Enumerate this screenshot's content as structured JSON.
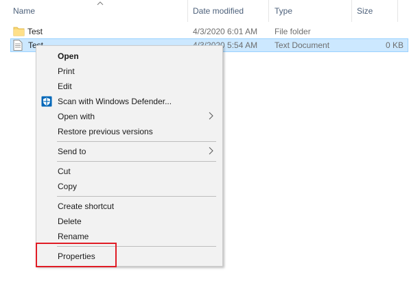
{
  "columns": {
    "name": "Name",
    "date_modified": "Date modified",
    "type": "Type",
    "size": "Size"
  },
  "rows": [
    {
      "name": "Test",
      "icon": "folder-icon",
      "date_modified": "4/3/2020 6:01 AM",
      "type": "File folder",
      "size": ""
    },
    {
      "name": "Test",
      "icon": "text-document-icon",
      "date_modified": "4/3/2020 5:54 AM",
      "type": "Text Document",
      "size": "0 KB",
      "selected": true
    }
  ],
  "context_menu": {
    "items": [
      {
        "label": "Open",
        "bold": true
      },
      {
        "label": "Print"
      },
      {
        "label": "Edit"
      },
      {
        "label": "Scan with Windows Defender...",
        "icon": "windows-defender-shield-icon"
      },
      {
        "label": "Open with",
        "submenu": true
      },
      {
        "label": "Restore previous versions"
      },
      {
        "label": "Send to",
        "submenu": true
      },
      {
        "label": "Cut"
      },
      {
        "label": "Copy"
      },
      {
        "label": "Create shortcut"
      },
      {
        "label": "Delete"
      },
      {
        "label": "Rename"
      },
      {
        "label": "Properties",
        "highlighted": true
      }
    ]
  },
  "colors": {
    "selection_bg": "#cce8ff",
    "selection_border": "#99d1ff",
    "menu_bg": "#f2f2f2",
    "highlight_border": "#e01b24",
    "header_text": "#4c607a",
    "defender_blue": "#0067b8",
    "folder_yellow": "#f8d775"
  }
}
